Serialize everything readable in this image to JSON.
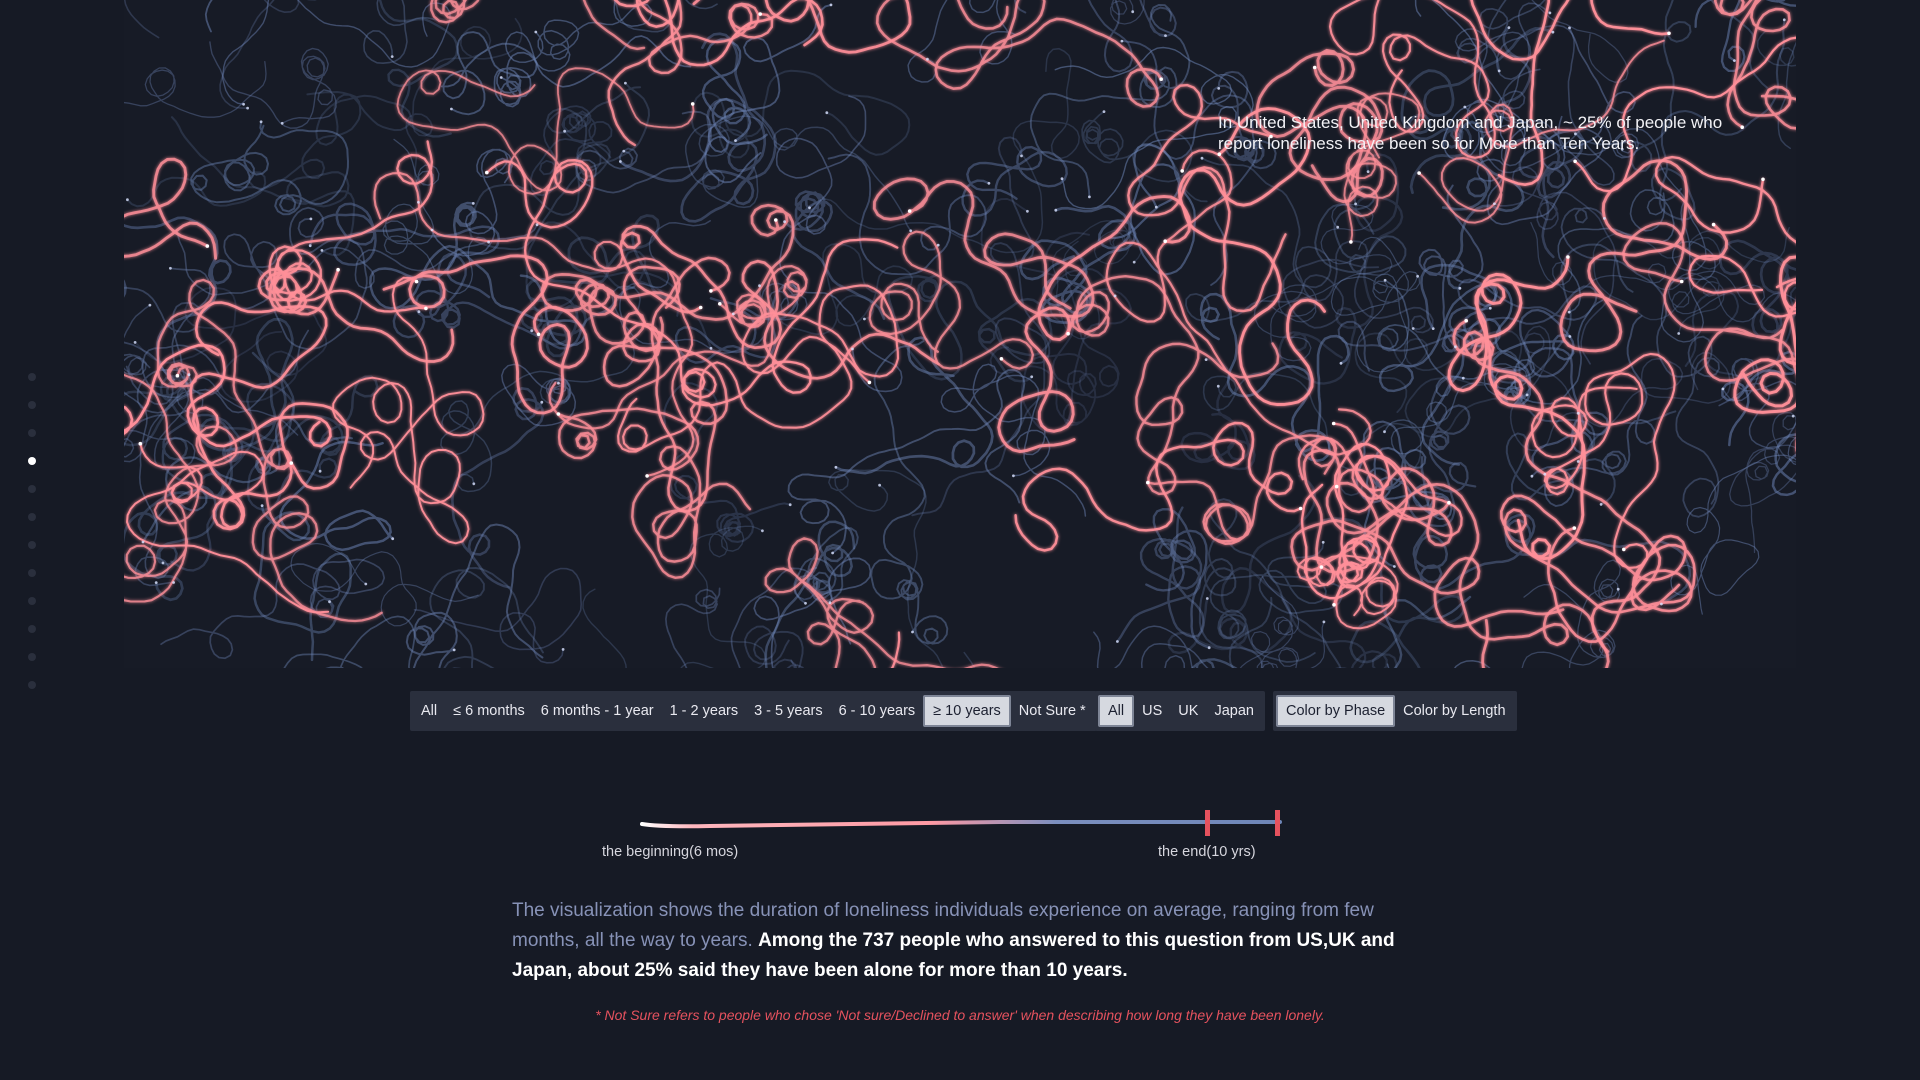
{
  "annotation": {
    "text": "In United States, United Kingdom and Japan, ~ 25% of people who report loneliness have been so for More than Ten Years."
  },
  "section_dots": {
    "count": 12,
    "active_index": 3
  },
  "filters": {
    "duration": [
      {
        "label": "All",
        "active": false
      },
      {
        "label": "≤ 6 months",
        "active": false
      },
      {
        "label": "6 months - 1 year",
        "active": false
      },
      {
        "label": "1 - 2 years",
        "active": false
      },
      {
        "label": "3 - 5 years",
        "active": false
      },
      {
        "label": "6 - 10 years",
        "active": false
      },
      {
        "label": "≥ 10 years",
        "active": true
      },
      {
        "label": "Not Sure *",
        "active": false
      }
    ],
    "country": [
      {
        "label": "All",
        "active": true
      },
      {
        "label": "US",
        "active": false
      },
      {
        "label": "UK",
        "active": false
      },
      {
        "label": "Japan",
        "active": false
      }
    ],
    "color_mode": [
      {
        "label": "Color by Phase",
        "active": true
      },
      {
        "label": "Color by Length",
        "active": false
      }
    ]
  },
  "legend": {
    "begin_label": "the beginning(6 mos)",
    "end_label": "the end(10 yrs)"
  },
  "description": {
    "plain": "The visualization shows the duration of loneliness individuals experience on average, ranging from few months, all the way to years. ",
    "bold": "Among the 737 people who answered to this question from US,UK and Japan, about 25% said they have been alone for more than 10 years."
  },
  "footnote": "* Not Sure refers to people who chose 'Not sure/Declined to answer' when describing how long they have been lonely.",
  "colors": {
    "background": "#161a25",
    "pink_line": "#ff8f99",
    "blue_line": "#6e86b8",
    "accent_red": "#e5525e",
    "button_bg": "#2a2f3d",
    "button_active_bg": "#d6d9e0"
  }
}
